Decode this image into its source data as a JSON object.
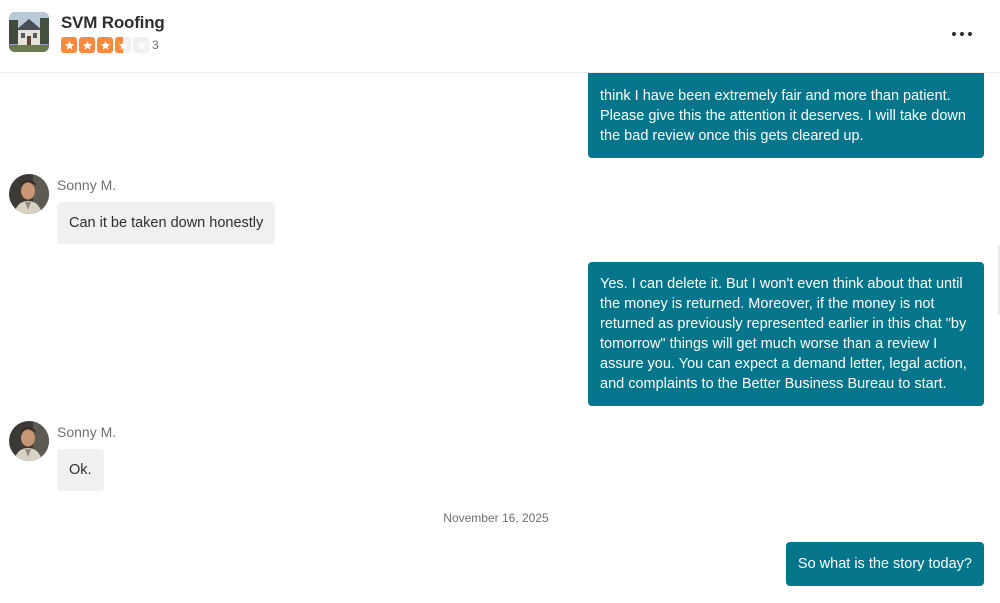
{
  "header": {
    "business_name": "SVM Roofing",
    "rating": 3.5,
    "review_count": "3",
    "more_icon": "more-horizontal-icon",
    "star_color": "#fb8b3c"
  },
  "messages": [
    {
      "direction": "outgoing",
      "text": "think I have been extremely fair and more than patient. Please give this the attention it deserves. I will take down the bad review once this gets cleared up."
    },
    {
      "direction": "incoming",
      "sender": "Sonny M.",
      "text": "Can it be taken down honestly"
    },
    {
      "direction": "outgoing",
      "text": "Yes. I can delete it. But I won't even think about that until the money is returned.  Moreover, if the money is not returned as previously represented earlier in this chat \"by tomorrow\" things will get much worse than a review I assure you. You can expect a demand letter, legal action, and complaints to the Better Business Bureau to start."
    },
    {
      "direction": "incoming",
      "sender": "Sonny M.",
      "text": "Ok."
    },
    {
      "direction": "date",
      "text": "November 16, 2025"
    },
    {
      "direction": "outgoing",
      "text": "So what is the story today?"
    }
  ],
  "colors": {
    "outgoing_bubble": "#04758a",
    "incoming_bubble": "#f0f0f0"
  }
}
